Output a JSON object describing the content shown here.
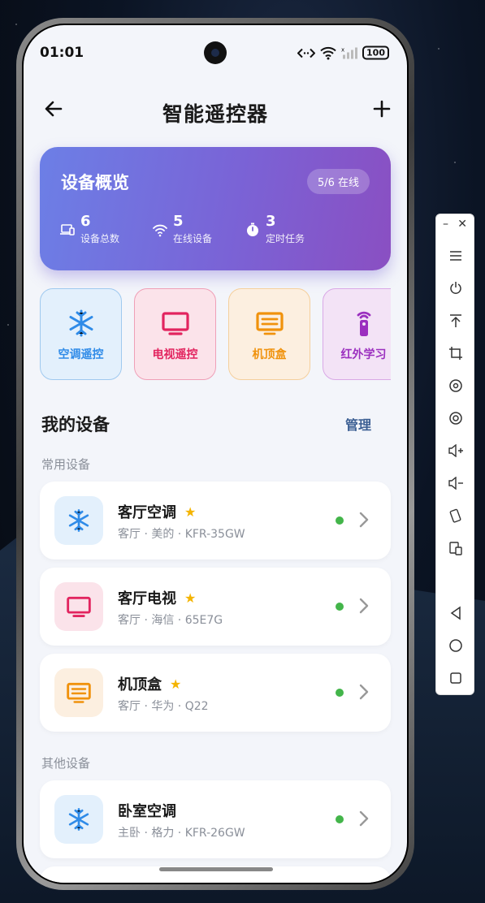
{
  "status": {
    "time": "01:01",
    "battery": "100"
  },
  "header": {
    "title": "智能遥控器"
  },
  "overview": {
    "title": "设备概览",
    "online_badge": "5/6 在线",
    "stats": [
      {
        "value": "6",
        "label": "设备总数",
        "icon": "device-icon"
      },
      {
        "value": "5",
        "label": "在线设备",
        "icon": "wifi-icon"
      },
      {
        "value": "3",
        "label": "定时任务",
        "icon": "timer-icon"
      }
    ]
  },
  "quick": [
    {
      "label": "空调遥控",
      "icon": "snowflake-icon",
      "color": "#2f8be8",
      "bg": "#e3f0fc",
      "border": "#9fc9ef"
    },
    {
      "label": "电视遥控",
      "icon": "tv-icon",
      "color": "#e2245f",
      "bg": "#fbe3ea",
      "border": "#ef9fb7"
    },
    {
      "label": "机顶盒",
      "icon": "settop-box-icon",
      "color": "#f0920c",
      "bg": "#fcefe0",
      "border": "#f5cf9c"
    },
    {
      "label": "红外学习",
      "icon": "remote-icon",
      "color": "#9b2fbf",
      "bg": "#f3e3f6",
      "border": "#d9a8e6"
    }
  ],
  "devices": {
    "title": "我的设备",
    "manage": "管理",
    "common_label": "常用设备",
    "other_label": "其他设备",
    "common": [
      {
        "name": "客厅空调",
        "meta": "客厅 · 美的 · KFR-35GW",
        "icon": "snowflake-icon"
      },
      {
        "name": "客厅电视",
        "meta": "客厅 · 海信 · 65E7G",
        "icon": "tv-icon"
      },
      {
        "name": "机顶盒",
        "meta": "客厅 · 华为 · Q22",
        "icon": "settop-box-icon"
      }
    ],
    "other": [
      {
        "name": "卧室空调",
        "meta": "主卧 · 格力 · KFR-26GW",
        "icon": "snowflake-icon"
      }
    ]
  }
}
